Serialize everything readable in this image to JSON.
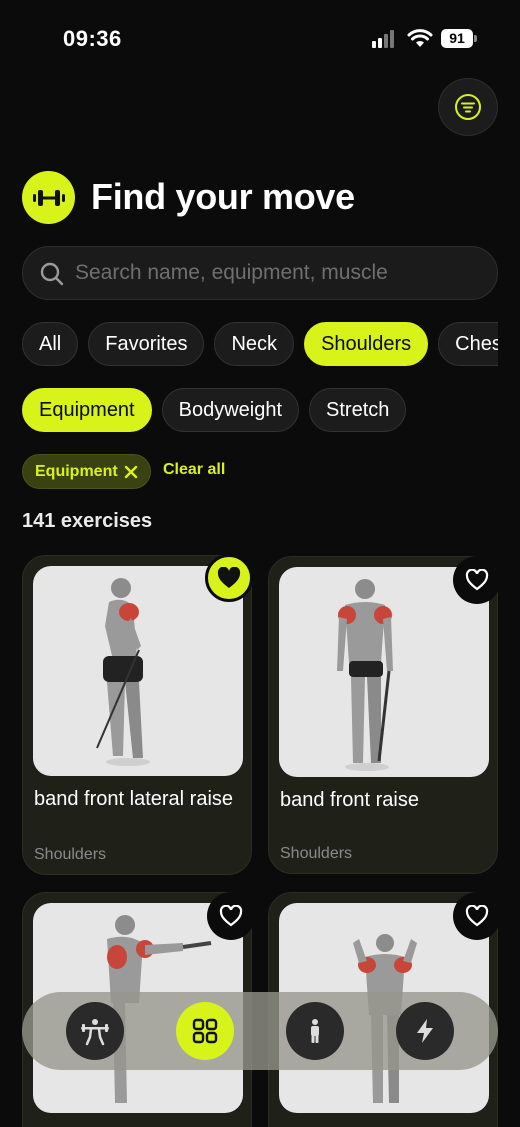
{
  "status_bar": {
    "time": "09:36",
    "battery": "91"
  },
  "header": {
    "title": "Find your move"
  },
  "search": {
    "placeholder": "Search name, equipment, muscle"
  },
  "categories": [
    "All",
    "Favorites",
    "Neck",
    "Shoulders",
    "Chest"
  ],
  "selected_category": "Shoulders",
  "types": [
    "Equipment",
    "Bodyweight",
    "Stretch"
  ],
  "selected_type": "Equipment",
  "applied_filter": {
    "label": "Equipment",
    "clear_label": "Clear all"
  },
  "result_count": "141 exercises",
  "exercises": [
    {
      "name": "band front lateral raise",
      "muscle": "Shoulders",
      "favorite": true
    },
    {
      "name": "band front raise",
      "muscle": "Shoulders",
      "favorite": false
    },
    {
      "name": "",
      "muscle": "",
      "favorite": false
    },
    {
      "name": "",
      "muscle": "",
      "favorite": false
    }
  ],
  "nav": {
    "items": [
      "barbell-icon",
      "grid-icon",
      "person-icon",
      "lightning-icon"
    ],
    "active": "grid-icon"
  },
  "colors": {
    "accent": "#d8f31a",
    "background": "#0b0b0b",
    "card": "#1f2119"
  }
}
